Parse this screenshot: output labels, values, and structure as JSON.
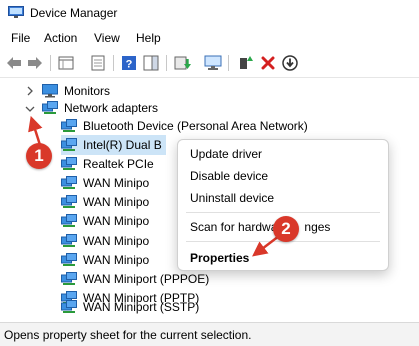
{
  "window": {
    "title": "Device Manager"
  },
  "menu": {
    "file": "File",
    "action": "Action",
    "view": "View",
    "help": "Help"
  },
  "toolbar": {
    "buttons": [
      "back-icon",
      "forward-icon",
      "properties-grid-icon",
      "show-hidden-icon",
      "help-icon",
      "action-pane-icon",
      "update-driver-icon",
      "scan-hardware-icon",
      "enable-device-icon",
      "uninstall-icon",
      "disable-device-icon"
    ]
  },
  "tree": {
    "monitors": "Monitors",
    "network_adapters": "Network adapters",
    "devices": [
      "Bluetooth Device (Personal Area Network)",
      "Intel(R) Dual B",
      "Realtek PCIe",
      "WAN Minipo",
      "WAN Minipo",
      "WAN Minipo",
      "WAN Minipo",
      "WAN Minipo",
      "WAN Miniport (PPPOE)",
      "WAN Miniport (PPTP)",
      "WAN Miniport (SSTP)"
    ]
  },
  "context_menu": {
    "update_driver": "Update driver",
    "disable_device": "Disable device",
    "uninstall_device": "Uninstall device",
    "scan": "Scan for hardwa",
    "scan_tail": "nges",
    "properties": "Properties"
  },
  "annotations": {
    "step1": "1",
    "step2": "2",
    "accent": "#d9382a"
  },
  "status": {
    "text": "Opens property sheet for the current selection."
  }
}
